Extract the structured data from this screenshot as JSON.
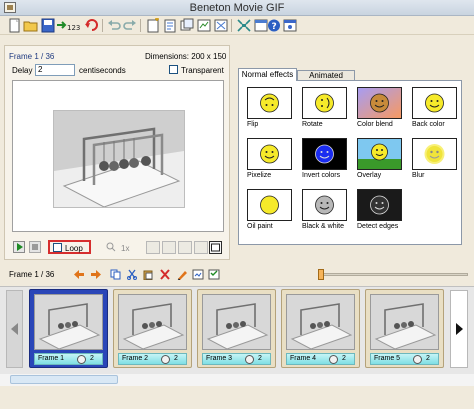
{
  "window": {
    "title": "Beneton Movie GIF"
  },
  "toolbar": {
    "icons": [
      "new-icon",
      "open-icon",
      "save-icon",
      "import-frames-icon",
      "renumber-icon",
      "refresh-icon",
      "undo-icon",
      "redo-icon",
      "insert-frame-icon",
      "properties-icon",
      "layers-icon",
      "optimize-icon",
      "fit-icon",
      "grid-icon",
      "help-icon",
      "about-icon"
    ]
  },
  "frame_panel": {
    "title": "Frame 1 / 36",
    "dimensions": "Dimensions: 200 x 150",
    "delay_label": "Delay",
    "delay_value": "2",
    "delay_unit": "centiseconds",
    "transparent_label": "Transparent",
    "transparent_checked": false
  },
  "playback": {
    "loop_label": "Loop",
    "loop_checked": false,
    "zoom_label": "1x"
  },
  "effects": {
    "tabs": [
      "Normal effects",
      "Animated effects"
    ],
    "active_tab": "Normal effects",
    "items": [
      {
        "label": "Flip"
      },
      {
        "label": "Rotate"
      },
      {
        "label": "Color blend"
      },
      {
        "label": "Back color"
      },
      {
        "label": "Pixelize"
      },
      {
        "label": "Invert colors"
      },
      {
        "label": "Overlay"
      },
      {
        "label": "Blur"
      },
      {
        "label": "Oil paint"
      },
      {
        "label": "Black & white"
      },
      {
        "label": "Detect edges"
      }
    ]
  },
  "frame_bar": {
    "label": "Frame 1 / 36"
  },
  "timeline": {
    "frames": [
      {
        "name": "Frame 1",
        "delay": "2",
        "selected": true
      },
      {
        "name": "Frame 2",
        "delay": "2",
        "selected": false
      },
      {
        "name": "Frame 3",
        "delay": "2",
        "selected": false
      },
      {
        "name": "Frame 4",
        "delay": "2",
        "selected": false
      },
      {
        "name": "Frame 5",
        "delay": "2",
        "selected": false
      }
    ]
  },
  "colors": {
    "accent_selected": "#2a46b8",
    "loop_highlight": "#d62e2e",
    "frame_footer": "#7fdfe4"
  }
}
